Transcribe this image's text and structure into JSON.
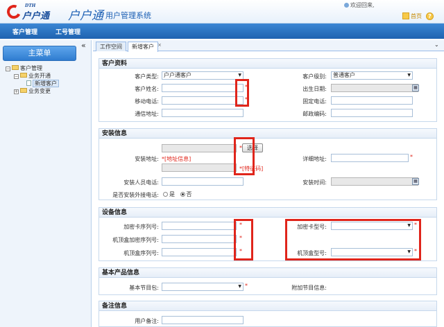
{
  "header": {
    "logo_dth": "DTH",
    "logo_cn": "户户通",
    "app_name": "户户通",
    "app_sub": "用户管理系统",
    "welcome": "欢迎回来,",
    "home_label": "首页",
    "help_icon": "?"
  },
  "nav": {
    "items": [
      "客户管理",
      "工号管理"
    ]
  },
  "sidebar": {
    "collapse": "«",
    "menu_title": "主菜单",
    "tree": [
      {
        "toggle": "⊟",
        "label": "客户管理"
      },
      {
        "toggle": "⊟",
        "label": "业务开通"
      },
      {
        "label": "新增客户"
      },
      {
        "toggle": "⊞",
        "label": "业务变更"
      }
    ]
  },
  "tabs": [
    {
      "label": "工作空间"
    },
    {
      "label": "新增客户",
      "close": "×"
    }
  ],
  "tab_dropdown": "⌄",
  "sections": {
    "customer": {
      "title": "客户资料",
      "type_label": "客户类型:",
      "type_value": "户户通客户",
      "level_label": "客户级别:",
      "level_value": "普通客户",
      "name_label": "客户姓名:",
      "dob_label": "出生日期:",
      "mobile_label": "移动电话:",
      "landline_label": "固定电话:",
      "address_label": "通信地址:",
      "zip_label": "邮政编码:"
    },
    "install": {
      "title": "安装信息",
      "addr_label": "安装地址:",
      "select_button": "选择",
      "addr_note": "*[地址信息]",
      "feature_note": "*[特征码]",
      "detail_label": "详细地址:",
      "installer_phone_label": "安装人员电话:",
      "time_label": "安装时间:",
      "external_label": "是否安装外接电话:",
      "radio_yes": "是",
      "radio_no": "否"
    },
    "device": {
      "title": "设备信息",
      "card_serial_label": "加密卡序列号:",
      "card_model_label": "加密卡型号:",
      "stb_crypt_label": "机顶盒加密序列号:",
      "stb_serial_label": "机顶盒序列号:",
      "stb_model_label": "机顶盒型号:"
    },
    "product": {
      "title": "基本产品信息",
      "package_label": "基本节目包:",
      "addon_label": "附加节目信息:"
    },
    "notes": {
      "title": "备注信息",
      "remark_label": "用户备注:"
    }
  },
  "star": "*",
  "dropdown_arrow": "▼",
  "calendar_icon": "▦",
  "colors": {
    "nav_blue": "#1f63b0",
    "highlight_red": "#e0251b",
    "section_border": "#c6d8ec"
  }
}
